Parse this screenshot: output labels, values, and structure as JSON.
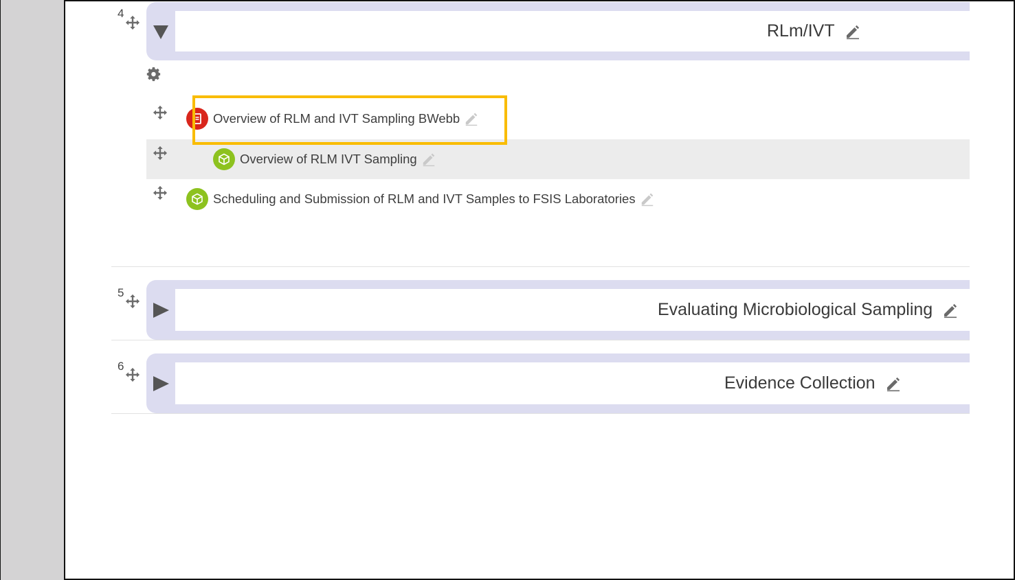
{
  "sections": [
    {
      "number": "4",
      "title": "RLm/IVT",
      "state": "expanded"
    },
    {
      "number": "5",
      "title": "Evaluating Microbiological Sampling",
      "state": "collapsed"
    },
    {
      "number": "6",
      "title": "Evidence Collection",
      "state": "collapsed"
    }
  ],
  "activities": [
    {
      "label": "Overview of RLM and IVT Sampling BWebb",
      "icon": "file-red-icon",
      "color": "#d9261c"
    },
    {
      "label": "Overview of RLM IVT Sampling",
      "icon": "package-green-icon",
      "color": "#8dc21f"
    },
    {
      "label": "Scheduling and Submission of RLM and IVT Samples to FSIS Laboratories",
      "icon": "package-green-icon",
      "color": "#8dc21f"
    }
  ],
  "colors": {
    "section_bg": "#dcdcf0",
    "highlight_border": "#f9bc00",
    "sidebar_bg": "#d4d3d4"
  }
}
